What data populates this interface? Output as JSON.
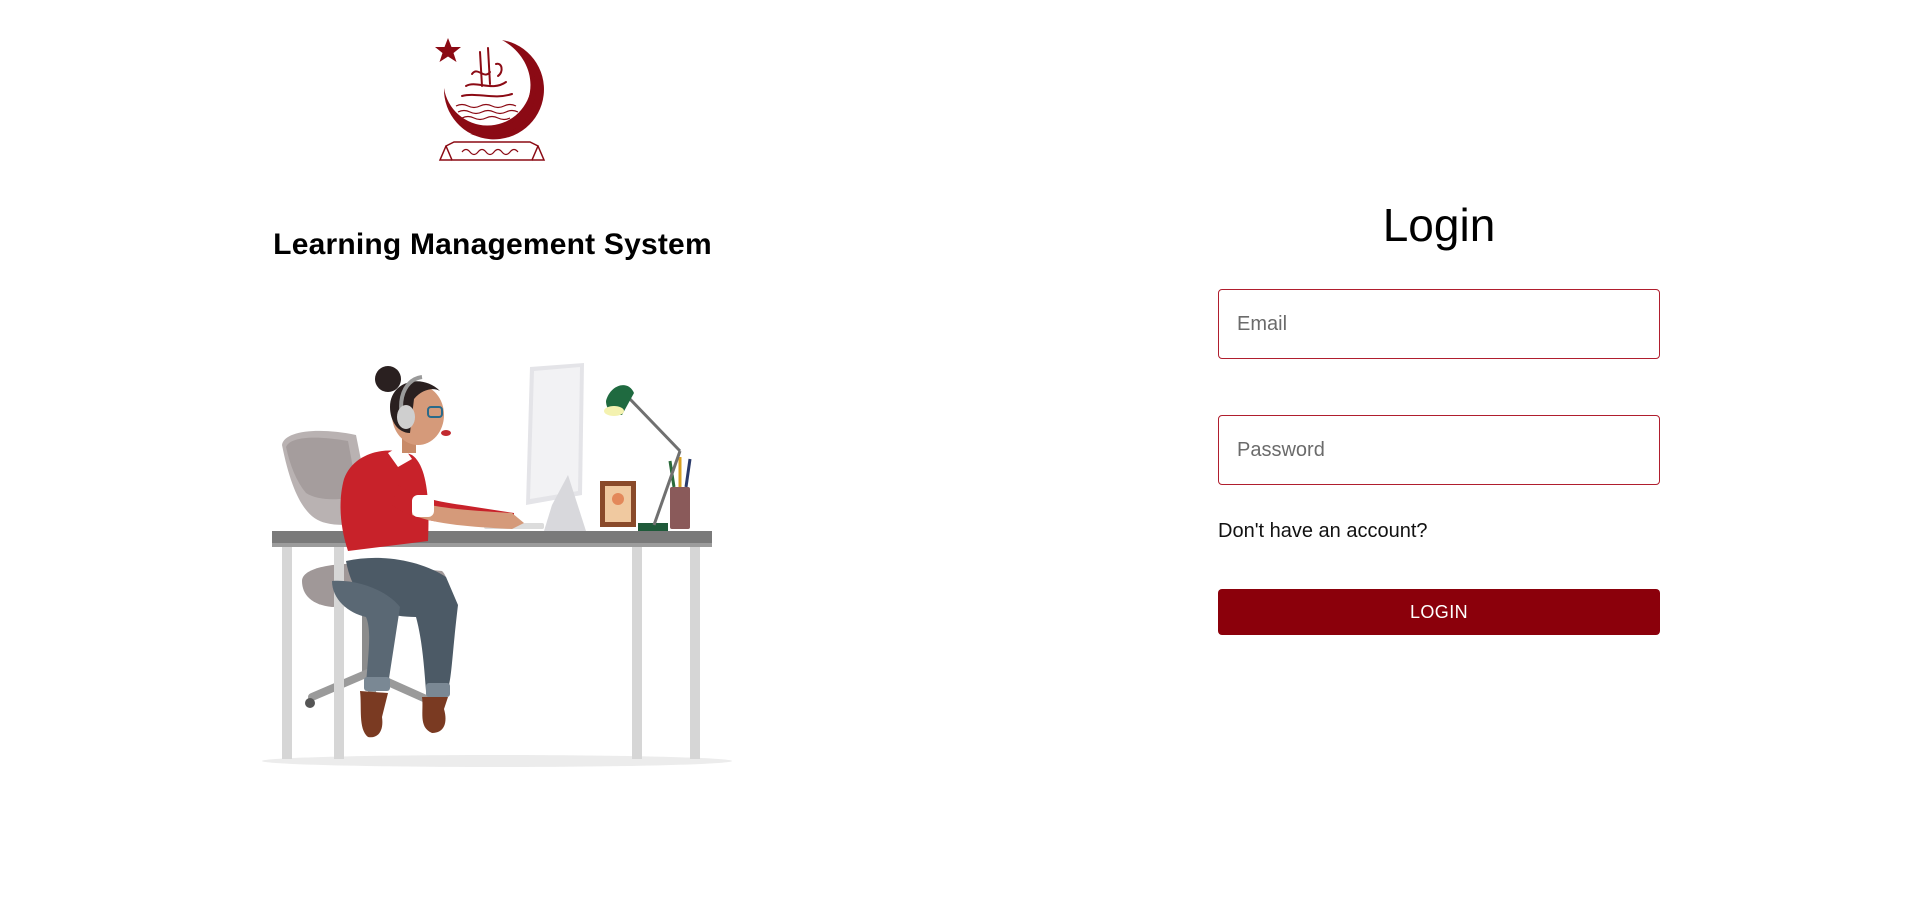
{
  "brand": {
    "title": "Learning Management System",
    "logo_icon": "university-crescent-star-logo",
    "accent_color": "#8b000b"
  },
  "illustration": {
    "icon": "woman-working-at-desk-illustration"
  },
  "login": {
    "title": "Login",
    "email_placeholder": "Email",
    "email_value": "",
    "password_placeholder": "Password",
    "password_value": "",
    "signup_prompt": "Don't have an account?",
    "submit_label": "LOGIN"
  }
}
